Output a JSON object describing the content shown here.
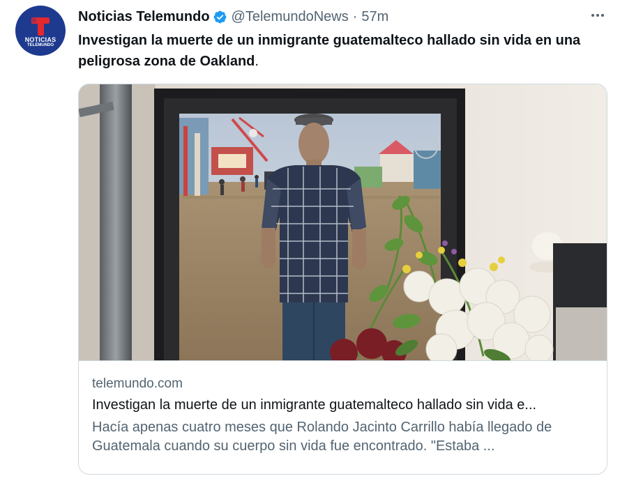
{
  "author": {
    "display_name": "Noticias Telemundo",
    "handle": "@TelemundoNews",
    "separator": "·",
    "time": "57m",
    "avatar_text": "NOTICIAS",
    "avatar_subtext": "TELEMUNDO",
    "avatar_color": "#1d3a8f",
    "verified_color": "#1d9bf0"
  },
  "tweet": {
    "text_bold": "Investigan la muerte de un inmigrante guatemalteco hallado sin vida en una peligrosa zona de Oakland",
    "text_end": "."
  },
  "card": {
    "domain": "telemundo.com",
    "title": "Investigan la muerte de un inmigrante guatemalteco hallado sin vida e...",
    "description": "Hacía apenas cuatro meses que Rolando Jacinto Carrillo había llegado de Guatemala cuando su cuerpo sin vida fue encontrado. \"Estaba ..."
  },
  "icons": {
    "more": "more-horizontal-icon",
    "verified": "verified-badge-icon"
  }
}
